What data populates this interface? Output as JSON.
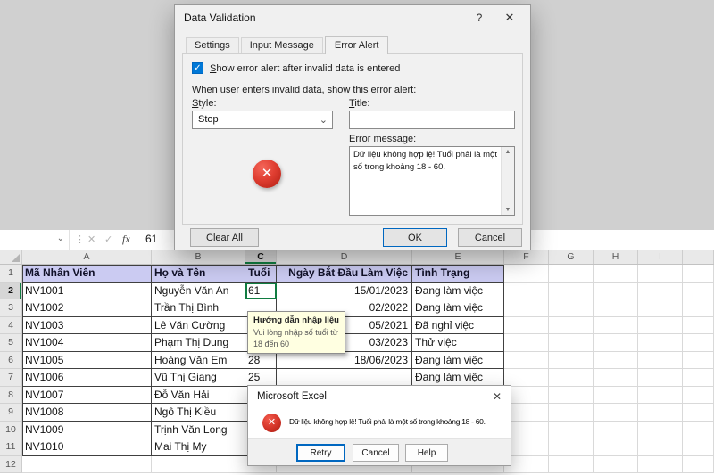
{
  "colors": {
    "selection_green": "#107C41",
    "table_header_fill": "#CBCBF2",
    "stop_icon_red": "#C0261B",
    "default_button_blue": "#0067C0",
    "checkbox_blue": "#0078D7",
    "tooltip_yellow": "#FFFFE1"
  },
  "icons": {
    "chevron_down": "⌄",
    "dots": "⋮",
    "cancel_entry": "✕",
    "enter_entry": "✓",
    "close": "✕",
    "help": "?",
    "check": "✓",
    "x_mark": "✕",
    "scroll_up": "▲",
    "scroll_down": "▼"
  },
  "formula_bar": {
    "fx_label": "fx",
    "cell_value": "61"
  },
  "sheet": {
    "column_letters": [
      "A",
      "B",
      "C",
      "D",
      "E",
      "F",
      "G",
      "H",
      "I"
    ],
    "selected_column": "C",
    "selected_row": 2,
    "active_cell": "C2",
    "rows": [
      {
        "n": 1,
        "header": true,
        "cells": [
          "Mã Nhân Viên",
          "Họ và Tên",
          "Tuổi",
          "Ngày Bắt Đầu Làm Việc",
          "Tình Trạng"
        ]
      },
      {
        "n": 2,
        "cells": [
          "NV1001",
          "Nguyễn Văn An",
          "61",
          "15/01/2023",
          "Đang làm việc"
        ]
      },
      {
        "n": 3,
        "cells": [
          "NV1002",
          "Trần Thị Bình",
          "",
          "02/2022",
          "Đang làm việc"
        ]
      },
      {
        "n": 4,
        "cells": [
          "NV1003",
          "Lê Văn Cường",
          "",
          "05/2021",
          "Đã nghỉ việc"
        ]
      },
      {
        "n": 5,
        "cells": [
          "NV1004",
          "Phạm Thị Dung",
          "",
          "03/2023",
          "Thử việc"
        ]
      },
      {
        "n": 6,
        "cells": [
          "NV1005",
          "Hoàng Văn Em",
          "28",
          "18/06/2023",
          "Đang làm việc"
        ]
      },
      {
        "n": 7,
        "cells": [
          "NV1006",
          "Vũ Thị Giang",
          "25",
          "",
          "Đang làm việc"
        ]
      },
      {
        "n": 8,
        "cells": [
          "NV1007",
          "Đỗ Văn Hải",
          "",
          "",
          ""
        ]
      },
      {
        "n": 9,
        "cells": [
          "NV1008",
          "Ngô Thị Kiều",
          "",
          "",
          ""
        ]
      },
      {
        "n": 10,
        "cells": [
          "NV1009",
          "Trịnh Văn Long",
          "",
          "",
          ""
        ]
      },
      {
        "n": 11,
        "cells": [
          "NV1010",
          "Mai Thị My",
          "",
          "",
          ""
        ]
      },
      {
        "n": 12,
        "cells": [
          "",
          "",
          "",
          "",
          ""
        ]
      }
    ]
  },
  "input_tooltip": {
    "title": "Hướng dẫn nhập liệu",
    "body": "Vui lòng nhập số tuổi từ 18 đến 60"
  },
  "data_validation_dialog": {
    "title": "Data Validation",
    "tabs": [
      "Settings",
      "Input Message",
      "Error Alert"
    ],
    "active_tab": "Error Alert",
    "checkbox_label": "Show error alert after invalid data is entered",
    "checkbox_checked": true,
    "prompt": "When user enters invalid data, show this error alert:",
    "style_label": "Style:",
    "style_value": "Stop",
    "title_label": "Title:",
    "title_value": "",
    "error_message_label": "Error message:",
    "error_message_value": "Dữ liệu không hợp lệ! Tuổi phải là một số trong khoảng 18 - 60.",
    "buttons": {
      "clear_all": "Clear All",
      "ok": "OK",
      "cancel": "Cancel"
    }
  },
  "error_dialog": {
    "title": "Microsoft Excel",
    "message": "Dữ liệu không hợp lệ! Tuổi phải là một số trong khoảng 18 - 60.",
    "buttons": [
      "Retry",
      "Cancel",
      "Help"
    ]
  }
}
